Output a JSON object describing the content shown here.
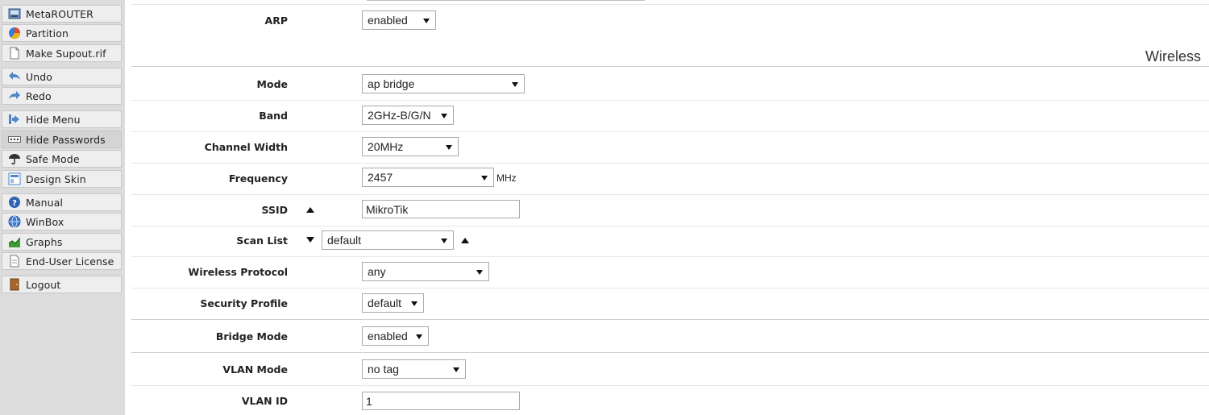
{
  "sidebar": {
    "items": [
      {
        "label": "MetaROUTER",
        "icon": "metarouter-icon"
      },
      {
        "label": "Partition",
        "icon": "partition-pie-icon"
      },
      {
        "label": "Make Supout.rif",
        "icon": "document-icon"
      },
      {
        "label": "Undo",
        "icon": "undo-arrow-icon"
      },
      {
        "label": "Redo",
        "icon": "redo-arrow-icon"
      },
      {
        "label": "Hide Menu",
        "icon": "hide-menu-icon"
      },
      {
        "label": "Hide Passwords",
        "icon": "password-dots-icon"
      },
      {
        "label": "Safe Mode",
        "icon": "umbrella-icon"
      },
      {
        "label": "Design Skin",
        "icon": "design-skin-icon"
      },
      {
        "label": "Manual",
        "icon": "help-icon"
      },
      {
        "label": "WinBox",
        "icon": "globe-icon"
      },
      {
        "label": "Graphs",
        "icon": "graph-icon"
      },
      {
        "label": "End-User License",
        "icon": "license-icon"
      },
      {
        "label": "Logout",
        "icon": "logout-door-icon"
      }
    ]
  },
  "form": {
    "section_title": "Wireless",
    "arp": {
      "label": "ARP",
      "value": "enabled"
    },
    "mode": {
      "label": "Mode",
      "value": "ap bridge"
    },
    "band": {
      "label": "Band",
      "value": "2GHz-B/G/N"
    },
    "channel_width": {
      "label": "Channel Width",
      "value": "20MHz"
    },
    "frequency": {
      "label": "Frequency",
      "value": "2457",
      "unit": "MHz"
    },
    "ssid": {
      "label": "SSID",
      "value": "MikroTik"
    },
    "scan_list": {
      "label": "Scan List",
      "value": "default"
    },
    "wireless_protocol": {
      "label": "Wireless Protocol",
      "value": "any"
    },
    "security_profile": {
      "label": "Security Profile",
      "value": "default"
    },
    "bridge_mode": {
      "label": "Bridge Mode",
      "value": "enabled"
    },
    "vlan_mode": {
      "label": "VLAN Mode",
      "value": "no tag"
    },
    "vlan_id": {
      "label": "VLAN ID",
      "value": "1"
    }
  },
  "colors": {
    "sidebar_bg": "#dcdcdc",
    "menu_item_bg": "#eeeeee",
    "row_border": "#e6e6e6"
  }
}
